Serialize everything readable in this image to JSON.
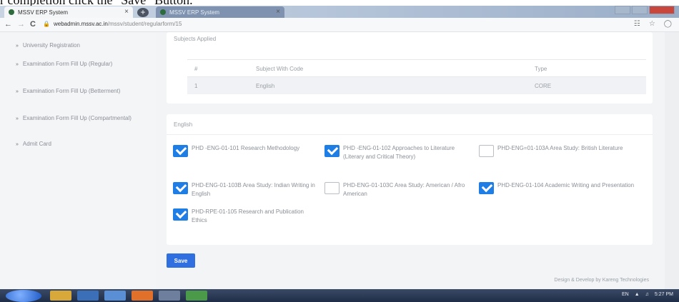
{
  "caption": "r completion click the \"Save\" Button.",
  "browser": {
    "tabs": [
      {
        "title": "MSSV ERP System",
        "close": "×"
      },
      {
        "title": "MSSV ERP System",
        "close": "×"
      }
    ],
    "new_tab": "+",
    "back": "←",
    "forward": "→",
    "reload": "C",
    "url_host": "webadmin.mssv.ac.in",
    "url_path": "/mssv/student/regularform/15",
    "addr_icons": [
      "translate-icon",
      "star-icon",
      "extension-icon"
    ]
  },
  "sidebar": {
    "items": [
      {
        "label": "University Registration"
      },
      {
        "label": "Examination Form Fill Up (Regular)"
      },
      {
        "label": "Examination Form Fill Up (Betterment)"
      },
      {
        "label": "Examination Form Fill Up (Compartmental)"
      },
      {
        "label": "Admit Card"
      }
    ]
  },
  "subjects_card": {
    "title": "Subjects Applied",
    "headers": [
      "#",
      "Subject With Code",
      "Type"
    ],
    "rows": [
      [
        "1",
        "English",
        "CORE"
      ]
    ]
  },
  "papers_card": {
    "title": "English",
    "papers": [
      {
        "label": "PHD -ENG-01-101 Research Methodology",
        "checked": true
      },
      {
        "label": "PHD -ENG-01-102 Approaches to Literature (Literary and Critical Theory)",
        "checked": true
      },
      {
        "label": "PHD-ENG=01-103A Area Study: British Literature",
        "checked": false
      },
      {
        "label": "PHD-ENG-01-103B Area Study: Indian Writing in English",
        "checked": true
      },
      {
        "label": "PHD-ENG-01-103C Area Study: American / Afro American",
        "checked": false
      },
      {
        "label": "PHD-ENG-01-104 Academic Writing and Presentation",
        "checked": true
      },
      {
        "label": "PHD-RPE-01-105 Research and Publication Ethics",
        "checked": true
      }
    ]
  },
  "save_label": "Save",
  "footer": "Design & Develop by Kareng Technologies",
  "taskbar": {
    "lang": "EN",
    "time": "5:27 PM"
  },
  "colors": {
    "accent": "#2f6fe0",
    "checkbox": "#1e7ee6"
  }
}
